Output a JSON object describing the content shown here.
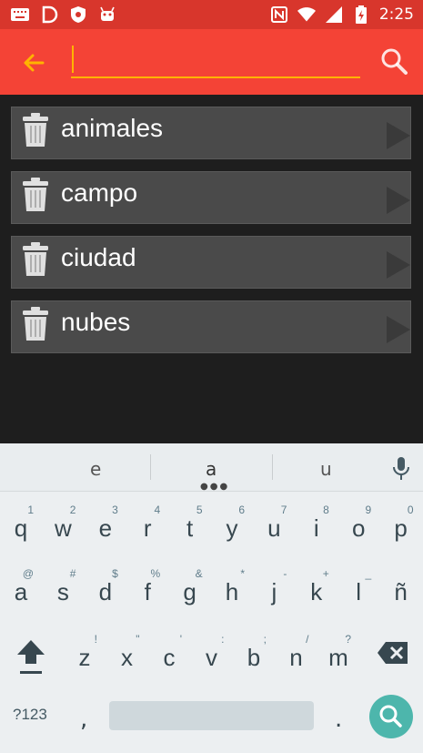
{
  "status_bar": {
    "time": "2:25",
    "icons": [
      "keyboard-icon",
      "d-app-icon",
      "badge-icon",
      "android-icon",
      "nfc-icon",
      "wifi-icon",
      "signal-icon",
      "battery-charging-icon"
    ]
  },
  "toolbar": {
    "search_value": "",
    "search_placeholder": "",
    "accent": "#ffb300",
    "background": "#f44336"
  },
  "list": {
    "items": [
      {
        "label": "animales"
      },
      {
        "label": "campo"
      },
      {
        "label": "ciudad"
      },
      {
        "label": "nubes"
      }
    ]
  },
  "keyboard": {
    "suggestions": [
      "e",
      "a",
      "u"
    ],
    "row1": [
      {
        "key": "q",
        "alt": "1"
      },
      {
        "key": "w",
        "alt": "2"
      },
      {
        "key": "e",
        "alt": "3"
      },
      {
        "key": "r",
        "alt": "4"
      },
      {
        "key": "t",
        "alt": "5"
      },
      {
        "key": "y",
        "alt": "6"
      },
      {
        "key": "u",
        "alt": "7"
      },
      {
        "key": "i",
        "alt": "8"
      },
      {
        "key": "o",
        "alt": "9"
      },
      {
        "key": "p",
        "alt": "0"
      }
    ],
    "row2": [
      {
        "key": "a",
        "alt": "@"
      },
      {
        "key": "s",
        "alt": "#"
      },
      {
        "key": "d",
        "alt": "$"
      },
      {
        "key": "f",
        "alt": "%"
      },
      {
        "key": "g",
        "alt": "&"
      },
      {
        "key": "h",
        "alt": "*"
      },
      {
        "key": "j",
        "alt": "-"
      },
      {
        "key": "k",
        "alt": "+"
      },
      {
        "key": "l",
        "alt": "_"
      },
      {
        "key": "ñ",
        "alt": ""
      }
    ],
    "row3": [
      {
        "key": "z",
        "alt": "!"
      },
      {
        "key": "x",
        "alt": "\""
      },
      {
        "key": "c",
        "alt": "'"
      },
      {
        "key": "v",
        "alt": ":"
      },
      {
        "key": "b",
        "alt": ";"
      },
      {
        "key": "n",
        "alt": "/"
      },
      {
        "key": "m",
        "alt": "?"
      }
    ],
    "symbols_label": "?123",
    "comma": ",",
    "period": ".",
    "action_color": "#4db6ac"
  }
}
